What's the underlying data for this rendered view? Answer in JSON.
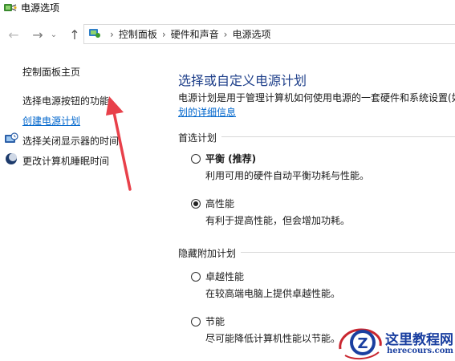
{
  "window": {
    "title": "电源选项"
  },
  "navigation": {
    "breadcrumbs": [
      "控制面板",
      "硬件和声音",
      "电源选项"
    ]
  },
  "sidebar": {
    "items": [
      {
        "label": "控制面板主页"
      },
      {
        "label": "选择电源按钮的功能"
      },
      {
        "label": "创建电源计划"
      },
      {
        "label": "选择关闭显示器的时间"
      },
      {
        "label": "更改计算机睡眠时间"
      }
    ]
  },
  "main": {
    "heading": "选择或自定义电源计划",
    "description": "电源计划是用于管理计算机如何使用电源的一套硬件和系统设置(如",
    "description_link": "划的详细信息",
    "preferred_group_label": "首选计划",
    "hidden_group_label": "隐藏附加计划",
    "plans": [
      {
        "name": "平衡 (推荐)",
        "desc": "利用可用的硬件自动平衡功耗与性能。",
        "selected": false
      },
      {
        "name": "高性能",
        "desc": "有利于提高性能，但会增加功耗。",
        "selected": true
      },
      {
        "name": "卓越性能",
        "desc": "在较高端电脑上提供卓越性能。",
        "selected": false
      },
      {
        "name": "节能",
        "desc": "尽可能降低计算机性能以节能。",
        "selected": false
      }
    ]
  },
  "watermark": {
    "title": "这里教程网",
    "url": "herecours.com",
    "logo_letter": "Z"
  },
  "colors": {
    "heading": "#1e3f8a",
    "link": "#0066cc",
    "arrow": "#e8404a",
    "watermark": "#1a3fa0"
  }
}
